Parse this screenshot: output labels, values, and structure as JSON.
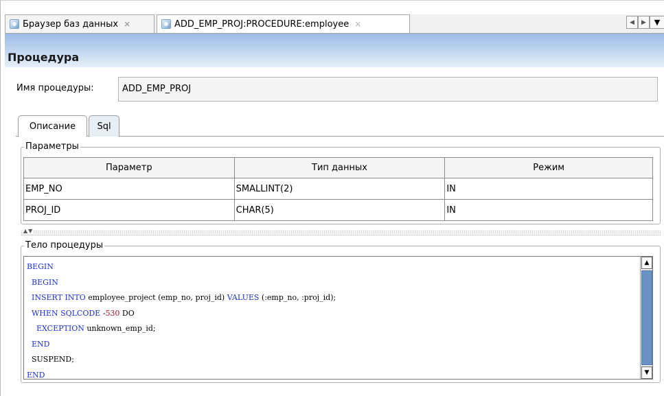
{
  "editor_tabs": [
    {
      "label": "Браузер баз данных",
      "close": "×"
    },
    {
      "label": "ADD_EMP_PROJ:PROCEDURE:employee",
      "close": "×"
    }
  ],
  "tab_nav": {
    "prev": "◀",
    "next": "▶",
    "menu": "▼"
  },
  "header": {
    "title": "Процедура"
  },
  "procedure_name": {
    "label": "Имя процедуры:",
    "value": "ADD_EMP_PROJ"
  },
  "sub_tabs": [
    {
      "label": "Описание",
      "active": true
    },
    {
      "label": "Sql",
      "active": false
    }
  ],
  "parameters": {
    "legend": "Параметры",
    "columns": [
      "Параметр",
      "Тип данных",
      "Режим"
    ],
    "rows": [
      [
        "EMP_NO",
        "SMALLINT(2)",
        "IN"
      ],
      [
        "PROJ_ID",
        "CHAR(5)",
        "IN"
      ]
    ]
  },
  "splitter": {
    "arrows": "▲▼"
  },
  "body": {
    "legend": "Тело процедуры",
    "tokens": {
      "begin": "BEGIN",
      "insert_into": "INSERT INTO",
      "insert_mid": " employee_project (emp_no, proj_id) ",
      "values": "VALUES",
      "insert_end": " (:emp_no, :proj_id);",
      "when": "WHEN",
      "sqlcode": "SQLCODE",
      "minus": " -",
      "code": "530",
      "do": " DO",
      "exception": "EXCEPTION",
      "exception_end": " unknown_emp_id;",
      "end": "END",
      "suspend": "SUSPEND;"
    }
  },
  "scrollbar": {
    "up": "▲",
    "down": "▼"
  },
  "colors": {
    "keyword": "#1b2fd6",
    "number": "#a8102a",
    "header_gradient_top": "#9bbde6"
  }
}
